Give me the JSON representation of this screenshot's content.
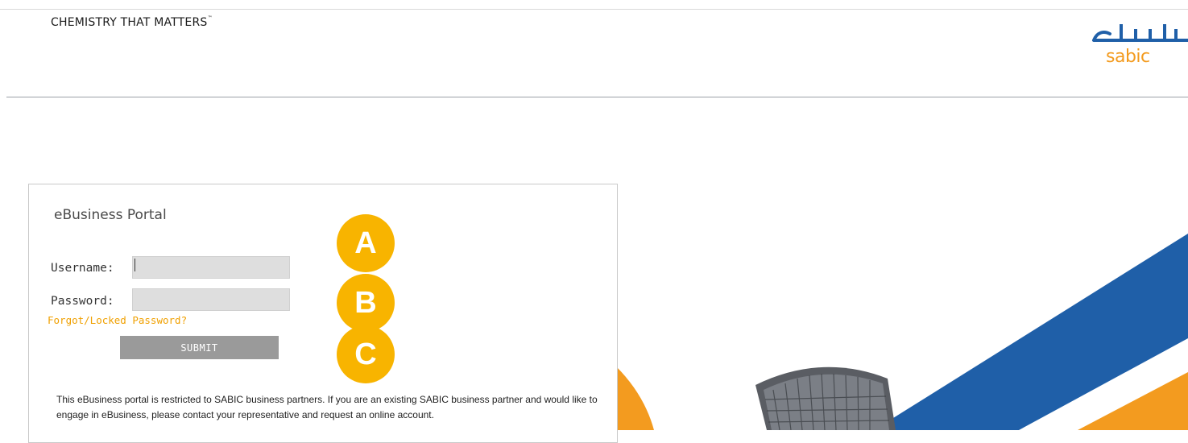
{
  "header": {
    "tagline": "CHEMISTRY THAT MATTERS",
    "tagline_mark": "™",
    "logo": {
      "arabic_text": "سابك",
      "latin_text": "sabic",
      "color": "#f39b1f"
    }
  },
  "login": {
    "title": "eBusiness Portal",
    "username_label": "Username:",
    "username_value": "",
    "password_label": "Password:",
    "password_value": "",
    "forgot_link": "Forgot/Locked Password?",
    "submit_label": "SUBMIT",
    "disclaimer": "This eBusiness portal is restricted to SABIC business partners. If you are an existing SABIC business partner and would like to engage in eBusiness, please contact your representative and request an online account."
  },
  "annotations": {
    "a": "A",
    "b": "B",
    "c": "C",
    "color": "#f8b400"
  },
  "colors": {
    "accent_orange": "#f39b1f",
    "brand_blue": "#1f5fa8",
    "link_color": "#f0a000",
    "button_gray": "#9a9a9a"
  },
  "icons": {
    "hero_decor": "office-chair-image"
  }
}
